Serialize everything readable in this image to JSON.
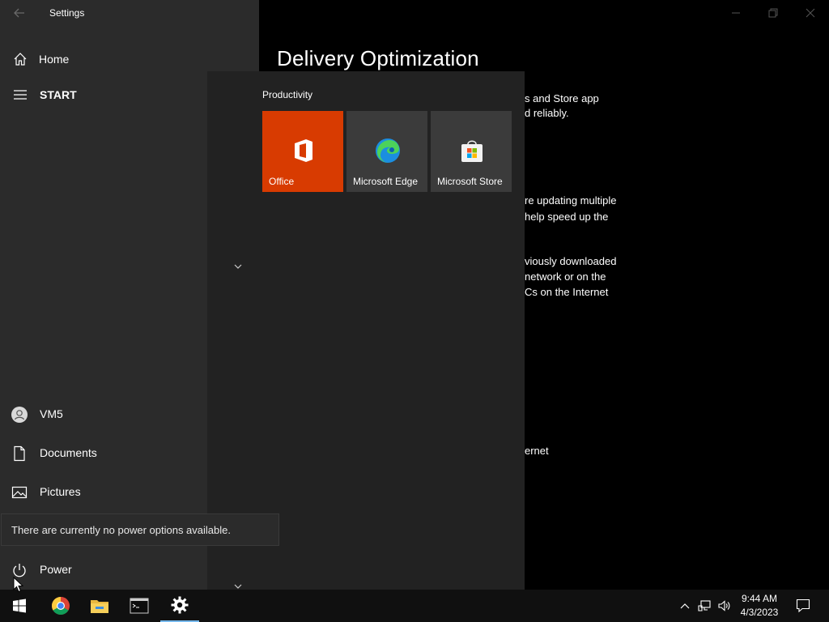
{
  "settings": {
    "app_title": "Settings",
    "home_label": "Home",
    "page_title": "Delivery Optimization",
    "content_fragments": [
      "s and Store app",
      "d reliably.",
      "re updating multiple",
      "help speed up the",
      "viously downloaded",
      "network or on the",
      "Cs on the Internet",
      "ernet"
    ]
  },
  "start": {
    "header_label": "START",
    "user_name": "VM5",
    "documents_label": "Documents",
    "pictures_label": "Pictures",
    "power_label": "Power",
    "power_tooltip": "There are currently no power options available.",
    "group_label": "Productivity",
    "tiles": [
      {
        "label": "Office",
        "color": "#d83b01",
        "icon": "office-icon"
      },
      {
        "label": "Microsoft Edge",
        "color": "#3b3b3b",
        "icon": "edge-icon"
      },
      {
        "label": "Microsoft Store",
        "color": "#3b3b3b",
        "icon": "store-icon"
      }
    ]
  },
  "taskbar": {
    "apps": [
      "windows-start-icon",
      "chrome-icon",
      "file-explorer-icon",
      "terminal-icon",
      "settings-gear-icon"
    ],
    "active_app": "settings-gear-icon",
    "time": "9:44 AM",
    "date": "4/3/2023"
  },
  "colors": {
    "accent": "#76b9ed",
    "office_tile": "#d83b01"
  }
}
